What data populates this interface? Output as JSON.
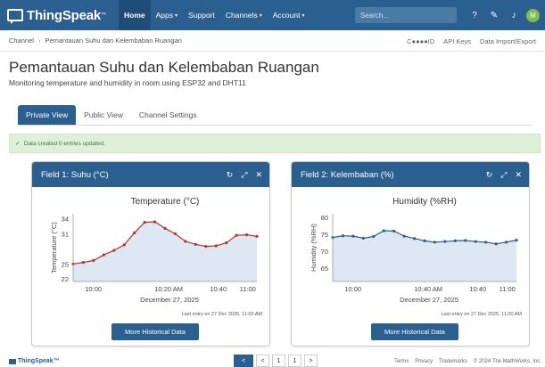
{
  "navbar": {
    "brand": "ThingSpeak",
    "brand_mark": "™",
    "items": [
      {
        "label": "Home",
        "caret": ""
      },
      {
        "label": "Apps",
        "caret": "▾"
      },
      {
        "label": "Support",
        "caret": ""
      },
      {
        "label": "Channels",
        "caret": "▾"
      },
      {
        "label": "Account",
        "caret": "▾"
      }
    ],
    "search_placeholder": "Search...",
    "icons": [
      "help-icon",
      "wrench-icon",
      "bell-icon"
    ],
    "avatar_initial": "M",
    "colors": {
      "bar": "#2b5f8f",
      "active": "#1f4d78",
      "avatar": "#7cc04b"
    }
  },
  "breadcrumb": {
    "root": "Channel",
    "current": "Pemantauan Suhu dan Kelembaban Ruangan",
    "links": [
      "C●●●●ID",
      "API Keys",
      "Data Import/Export"
    ]
  },
  "page": {
    "title": "Pemantauan Suhu dan Kelembaban Ruangan",
    "description": "Monitoring temperature and humidity in room using ESP32 and DHT11"
  },
  "tabs": [
    "Private View",
    "Public View",
    "Channel Settings"
  ],
  "alert": {
    "text": "Data created 0 entries updated."
  },
  "panels": [
    {
      "header": "Field 1: Suhu (°C)",
      "last_entry": "Last entry on 27 Dec 2025, 11:00 AM",
      "button": "More Historical Data"
    },
    {
      "header": "Field 2: Kelembaban (%)",
      "last_entry": "Last entry on 27 Dec 2025, 11:00 AM",
      "button": "More Historical Data"
    }
  ],
  "chart_data": [
    {
      "type": "line",
      "title": "Temperature (°C)",
      "ylabel": "Temperature (°C)",
      "xlabel": "December 27, 2025",
      "xticks": [
        "10:00",
        "10:20 AM",
        "10:40",
        "11:00"
      ],
      "yticks": [
        22,
        25,
        31,
        34
      ],
      "ylim": [
        21.5,
        35
      ],
      "color": "#b5322e",
      "fill": "#dde8f3",
      "values": [
        25.0,
        25.3,
        25.7,
        26.8,
        27.7,
        28.8,
        31.2,
        33.3,
        33.4,
        32.1,
        31.0,
        29.5,
        28.9,
        28.5,
        28.6,
        29.2,
        30.7,
        30.8,
        30.5
      ]
    },
    {
      "type": "line",
      "title": "Humidity (%RH)",
      "ylabel": "Humidity (%RH)",
      "xlabel": "December 27, 2025",
      "xticks": [
        "10:00",
        "10:40 AM",
        "10:40",
        "11:00"
      ],
      "yticks": [
        65,
        70,
        75,
        80
      ],
      "ylim": [
        61,
        81
      ],
      "color": "#2f5d8a",
      "fill": "#dde8f3",
      "values": [
        74.0,
        74.5,
        74.4,
        73.8,
        74.3,
        76.0,
        75.9,
        74.4,
        73.7,
        73.0,
        72.6,
        72.8,
        73.0,
        73.1,
        72.8,
        72.6,
        72.1,
        72.6,
        73.2
      ]
    }
  ],
  "footer": {
    "brand": "ThingSpeak™",
    "pager": [
      "<",
      "<",
      "1",
      "1",
      ">"
    ],
    "links": [
      "Terms",
      "Privacy",
      "Trademarks",
      "© 2024 The MathWorks, Inc."
    ]
  }
}
